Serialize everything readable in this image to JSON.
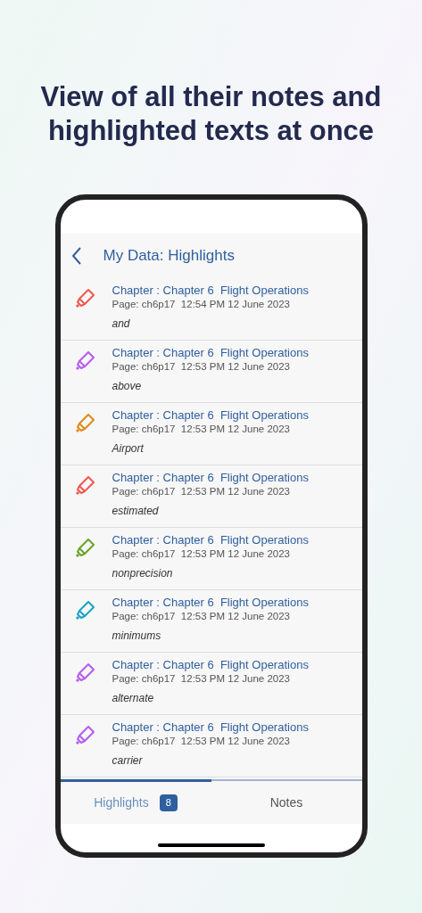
{
  "headline": "View of all their notes and highlighted texts at once",
  "screen": {
    "title": "My Data: Highlights",
    "highlights": [
      {
        "chapter": "Chapter : Chapter 6  Flight Operations",
        "meta": "Page: ch6p17  12:54 PM 12 June 2023",
        "text": "and",
        "color": "#f0574f"
      },
      {
        "chapter": "Chapter : Chapter 6  Flight Operations",
        "meta": "Page: ch6p17  12:53 PM 12 June 2023",
        "text": "above",
        "color": "#b65cf0"
      },
      {
        "chapter": "Chapter : Chapter 6  Flight Operations",
        "meta": "Page: ch6p17  12:53 PM 12 June 2023",
        "text": "Airport",
        "color": "#e08a1a"
      },
      {
        "chapter": "Chapter : Chapter 6  Flight Operations",
        "meta": "Page: ch6p17  12:53 PM 12 June 2023",
        "text": "estimated",
        "color": "#f0574f"
      },
      {
        "chapter": "Chapter : Chapter 6  Flight Operations",
        "meta": "Page: ch6p17  12:53 PM 12 June 2023",
        "text": "nonprecision",
        "color": "#6aa32a"
      },
      {
        "chapter": "Chapter : Chapter 6  Flight Operations",
        "meta": "Page: ch6p17  12:53 PM 12 June 2023",
        "text": "minimums",
        "color": "#1aa3c8"
      },
      {
        "chapter": "Chapter : Chapter 6  Flight Operations",
        "meta": "Page: ch6p17  12:53 PM 12 June 2023",
        "text": "alternate",
        "color": "#b65cf0"
      },
      {
        "chapter": "Chapter : Chapter 6  Flight Operations",
        "meta": "Page: ch6p17  12:53 PM 12 June 2023",
        "text": "carrier",
        "color": "#b65cf0"
      }
    ],
    "tabs": [
      {
        "label": "Highlights",
        "badge": "8",
        "selected": true
      },
      {
        "label": "Notes",
        "selected": false
      }
    ]
  }
}
